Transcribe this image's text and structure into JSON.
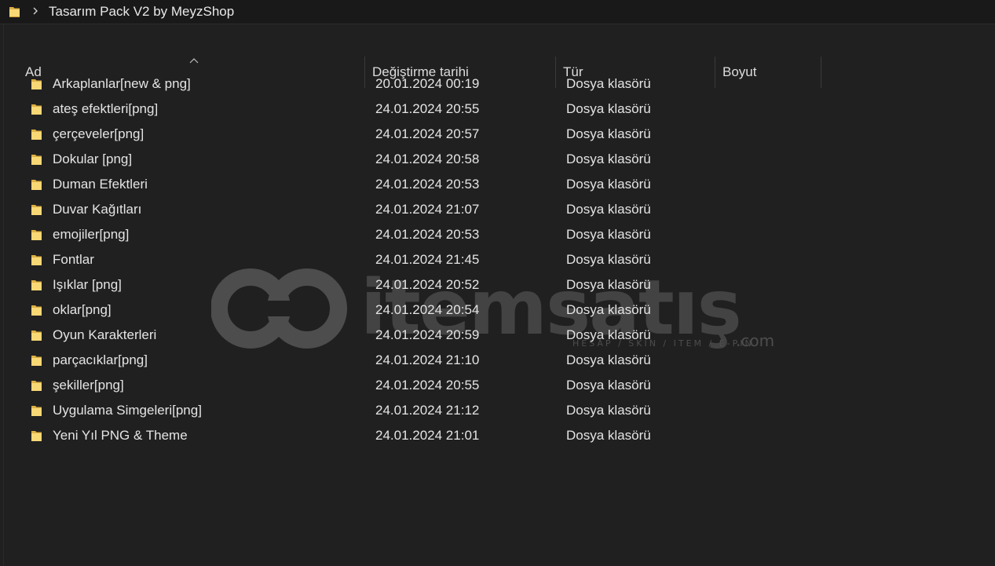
{
  "address_bar": {
    "path": "Tasarım Pack V2 by MeyzShop",
    "folder_icon": "folder-icon",
    "separator_icon": "chevron-right-icon"
  },
  "columns": {
    "name": "Ad",
    "date": "Değiştirme tarihi",
    "type": "Tür",
    "size": "Boyut",
    "sort_icon": "sort-ascending-icon"
  },
  "files": [
    {
      "name": "Arkaplanlar[new & png]",
      "date": "20.01.2024 00:19",
      "type": "Dosya klasörü"
    },
    {
      "name": "ateş efektleri[png]",
      "date": "24.01.2024 20:55",
      "type": "Dosya klasörü"
    },
    {
      "name": "çerçeveler[png]",
      "date": "24.01.2024 20:57",
      "type": "Dosya klasörü"
    },
    {
      "name": "Dokular [png]",
      "date": "24.01.2024 20:58",
      "type": "Dosya klasörü"
    },
    {
      "name": "Duman Efektleri",
      "date": "24.01.2024 20:53",
      "type": "Dosya klasörü"
    },
    {
      "name": "Duvar Kağıtları",
      "date": "24.01.2024 21:07",
      "type": "Dosya klasörü"
    },
    {
      "name": "emojiler[png]",
      "date": "24.01.2024 20:53",
      "type": "Dosya klasörü"
    },
    {
      "name": "Fontlar",
      "date": "24.01.2024 21:45",
      "type": "Dosya klasörü"
    },
    {
      "name": "Işıklar [png]",
      "date": "24.01.2024 20:52",
      "type": "Dosya klasörü"
    },
    {
      "name": "oklar[png]",
      "date": "24.01.2024 20:54",
      "type": "Dosya klasörü"
    },
    {
      "name": "Oyun Karakterleri",
      "date": "24.01.2024 20:59",
      "type": "Dosya klasörü"
    },
    {
      "name": "parçacıklar[png]",
      "date": "24.01.2024 21:10",
      "type": "Dosya klasörü"
    },
    {
      "name": "şekiller[png]",
      "date": "24.01.2024 20:55",
      "type": "Dosya klasörü"
    },
    {
      "name": "Uygulama Simgeleri[png]",
      "date": "24.01.2024 21:12",
      "type": "Dosya klasörü"
    },
    {
      "name": "Yeni Yıl PNG & Theme",
      "date": "24.01.2024 21:01",
      "type": "Dosya klasörü"
    }
  ],
  "watermark": {
    "brand": "itemsatış",
    "tagline": "HESAP / SKIN / ITEM / E-PIN",
    "suffix": ".com"
  },
  "colors": {
    "background": "#202020",
    "folder_yellow": "#f8d775",
    "folder_shadow": "#dcb044",
    "text": "#e4e4e4"
  }
}
